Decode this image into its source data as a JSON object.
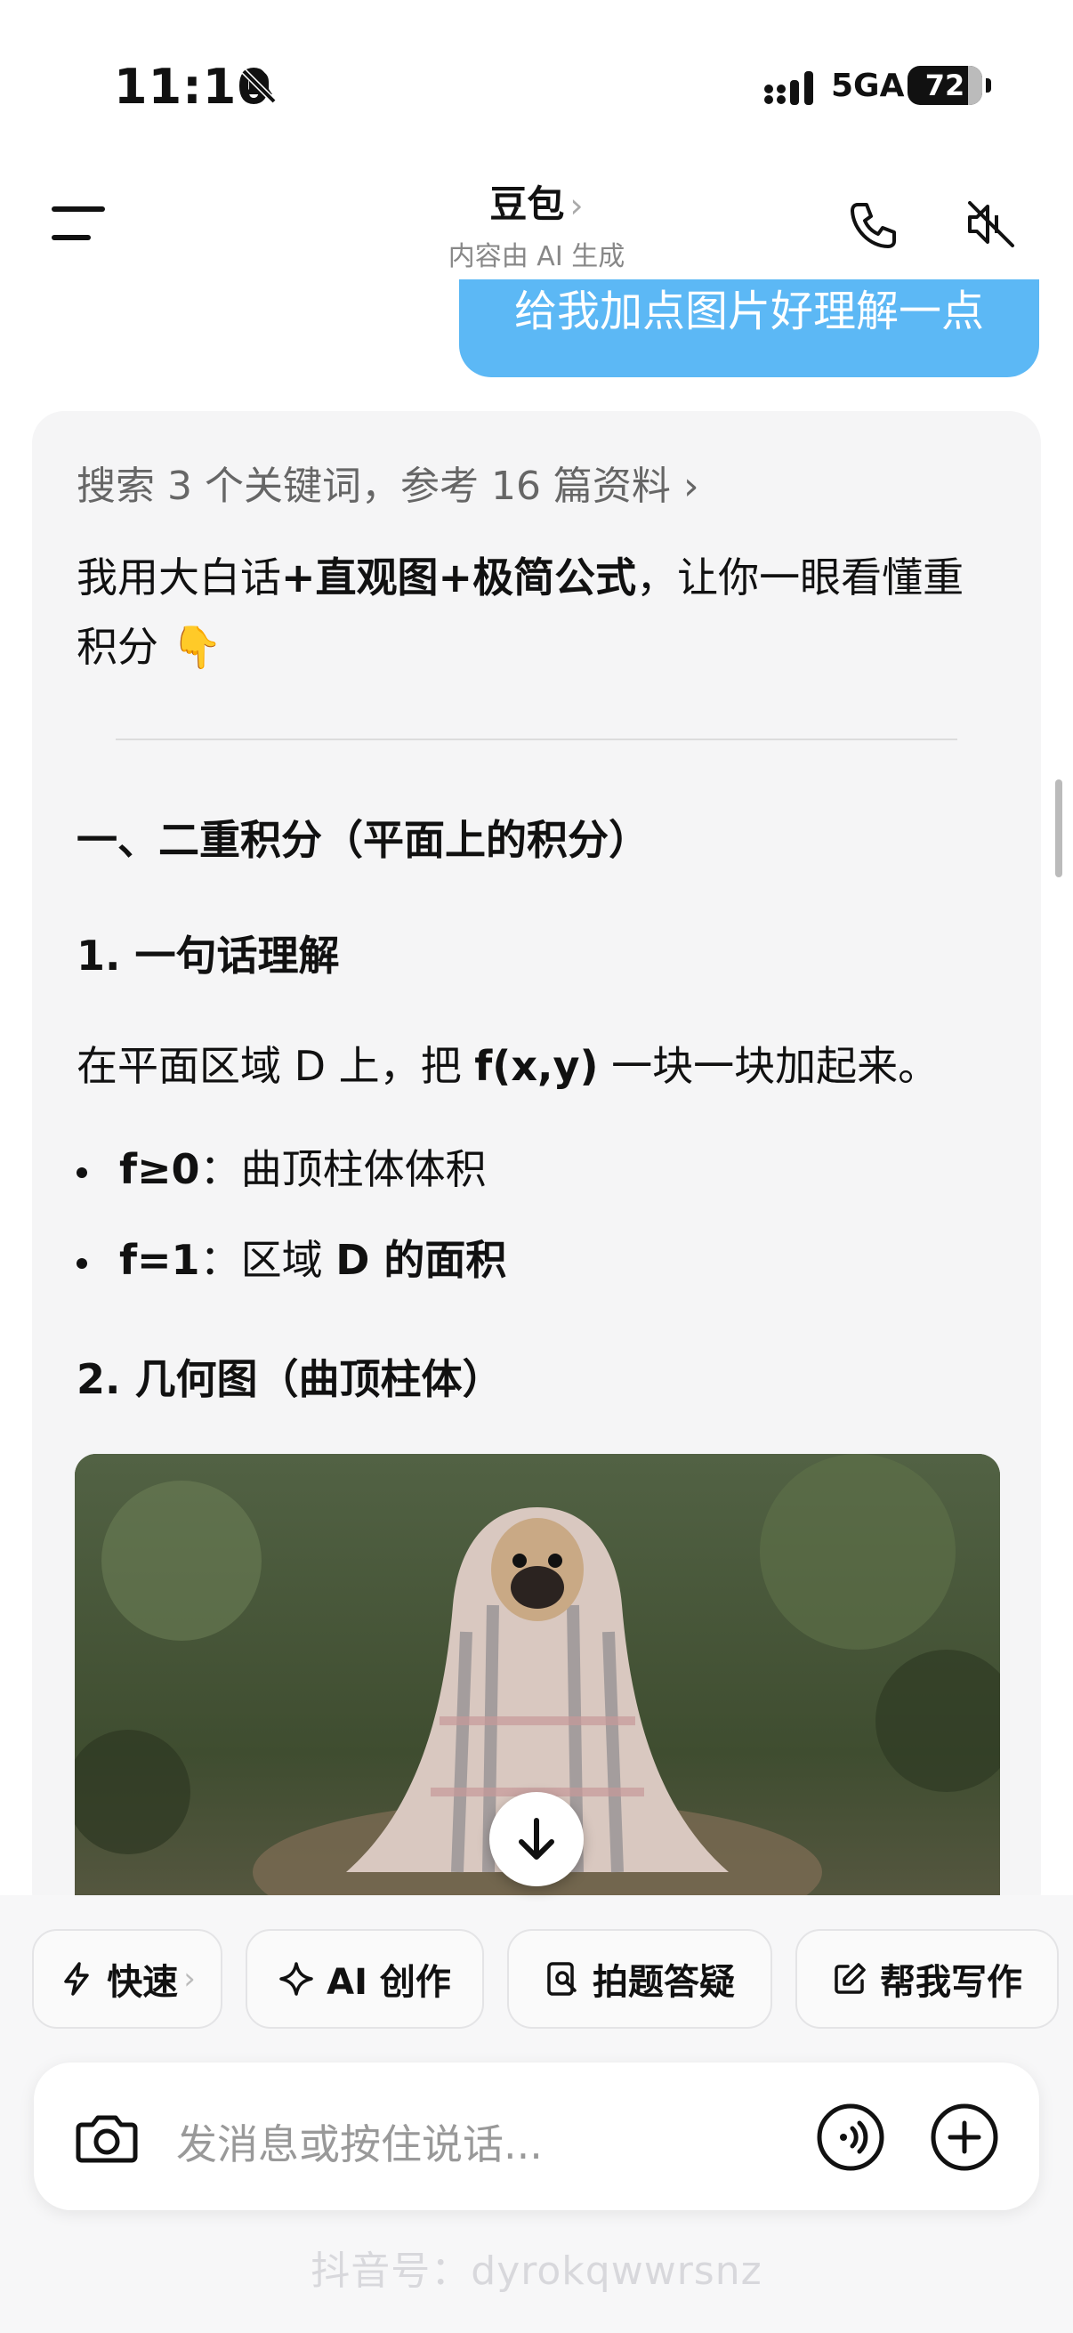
{
  "status_bar": {
    "time": "11:10",
    "network": "5GA",
    "battery": "72"
  },
  "header": {
    "title": "豆包",
    "title_chevron": "›",
    "subtitle": "内容由 AI 生成"
  },
  "user_message": "给我加点图片好理解一点",
  "answer": {
    "search_ref": "搜索 3 个关键词，参考 16 篇资料",
    "search_ref_chevron": "›",
    "intro_1": "我用大白话",
    "intro_plus1": "+",
    "intro_2": "直观图",
    "intro_plus2": "+",
    "intro_3": "极简公式",
    "intro_4": "，让你一眼看懂重积分",
    "intro_emoji": "👇",
    "heading_1": "一、二重积分（平面上的积分）",
    "heading_1_1": "1. 一句话理解",
    "para_1": "在平面区域 D 上，把 ",
    "para_1_bold": "f(x,y)",
    "para_1_end": " 一块一块加起来。",
    "bullets": [
      {
        "bold": "f≥0",
        "text": "：曲顶柱体体积"
      },
      {
        "bold": "f=1",
        "text": "：区域 ",
        "bold2": "D 的面积"
      }
    ],
    "heading_1_2": "2. 几何图（曲顶柱体）",
    "image_alt": "pug wrapped in plaid blanket"
  },
  "quick_actions": [
    {
      "label": "快速",
      "icon": "lightning-icon",
      "chevron": "›"
    },
    {
      "label": "AI 创作",
      "icon": "sparkle-icon"
    },
    {
      "label": "拍题答疑",
      "icon": "scan-question-icon"
    },
    {
      "label": "帮我写作",
      "icon": "edit-icon"
    }
  ],
  "input": {
    "placeholder": "发消息或按住说话..."
  },
  "watermark": "抖音号：dyrokqwwrsnz",
  "colors": {
    "accent_blue": "#5cb8f5",
    "card_bg": "#f5f5f6"
  }
}
